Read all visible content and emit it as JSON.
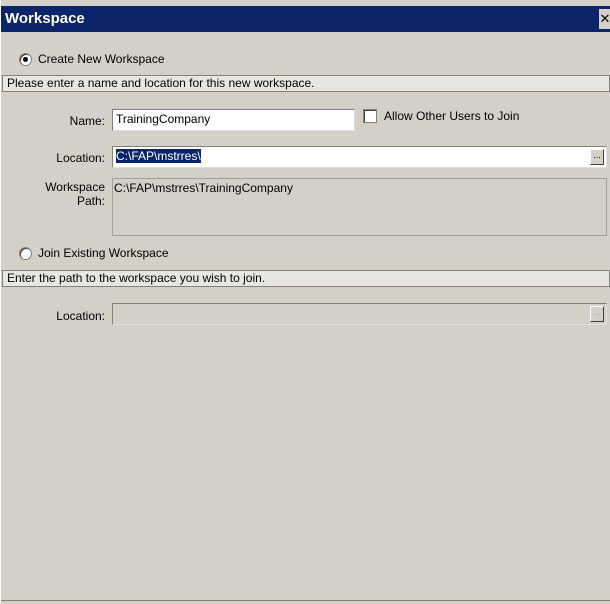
{
  "window": {
    "title": "Workspace",
    "close_glyph": "✕"
  },
  "create": {
    "radio_label": "Create New Workspace",
    "selected": true,
    "instructions": "Please enter a name and location for this new workspace.",
    "name_label": "Name:",
    "name_value": "TrainingCompany",
    "allow_users_label": "Allow Other Users to Join",
    "allow_users_checked": false,
    "location_label": "Location:",
    "location_value": "C:\\FAP\\mstrres\\",
    "browse_label": "...",
    "path_label_line1": "Workspace",
    "path_label_line2": "Path:",
    "path_value": "C:\\FAP\\mstrres\\TrainingCompany"
  },
  "join": {
    "radio_label": "Join Existing Workspace",
    "selected": false,
    "instructions": "Enter the path to the workspace you wish to join.",
    "location_label": "Location:",
    "location_value": "",
    "browse_label": "..."
  }
}
